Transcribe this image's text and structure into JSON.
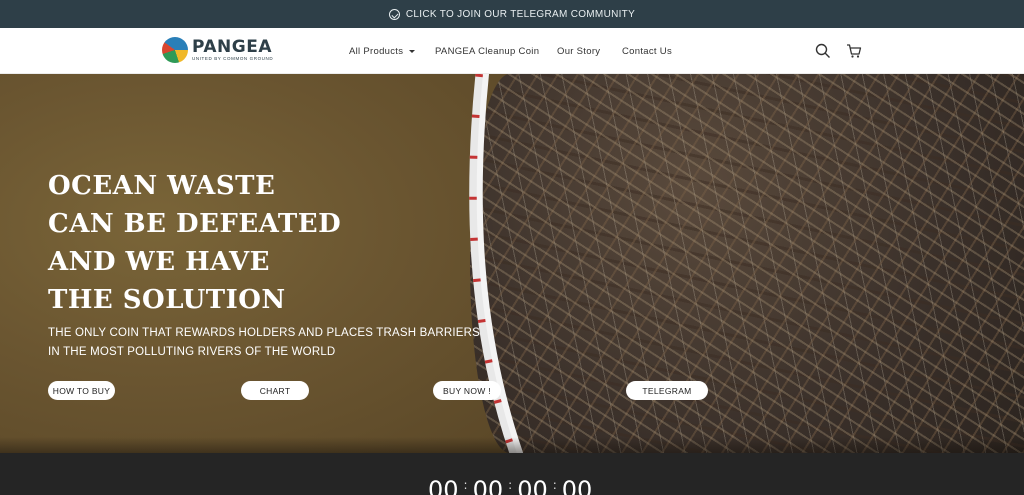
{
  "announcement": {
    "text": "CLICK TO JOIN OUR TELEGRAM COMMUNITY",
    "icon": "telegram-icon"
  },
  "header": {
    "logo": {
      "name": "PANGEA",
      "tagline": "UNITED BY COMMON GROUND"
    },
    "nav": [
      {
        "label": "All Products",
        "has_dropdown": true
      },
      {
        "label": "PANGEA Cleanup Coin"
      },
      {
        "label": "Our Story"
      },
      {
        "label": "Contact Us"
      }
    ],
    "icons": [
      "search-icon",
      "cart-icon"
    ]
  },
  "hero": {
    "headline": [
      "OCEAN WASTE",
      "CAN BE DEFEATED",
      "AND WE HAVE",
      "THE SOLUTION"
    ],
    "subtext": [
      "THE ONLY COIN THAT REWARDS HOLDERS AND PLACES TRASH BARRIERS",
      "IN THE MOST POLLUTING RIVERS OF THE WORLD"
    ],
    "buttons": [
      "HOW TO BUY",
      "CHART",
      "BUY NOW !",
      "TELEGRAM"
    ]
  },
  "countdown": {
    "values": [
      "00",
      "00",
      "00",
      "00"
    ]
  },
  "colors": {
    "topbar": "#2e3f48",
    "countdown_bg": "#252525",
    "button_bg": "#ffffff"
  }
}
